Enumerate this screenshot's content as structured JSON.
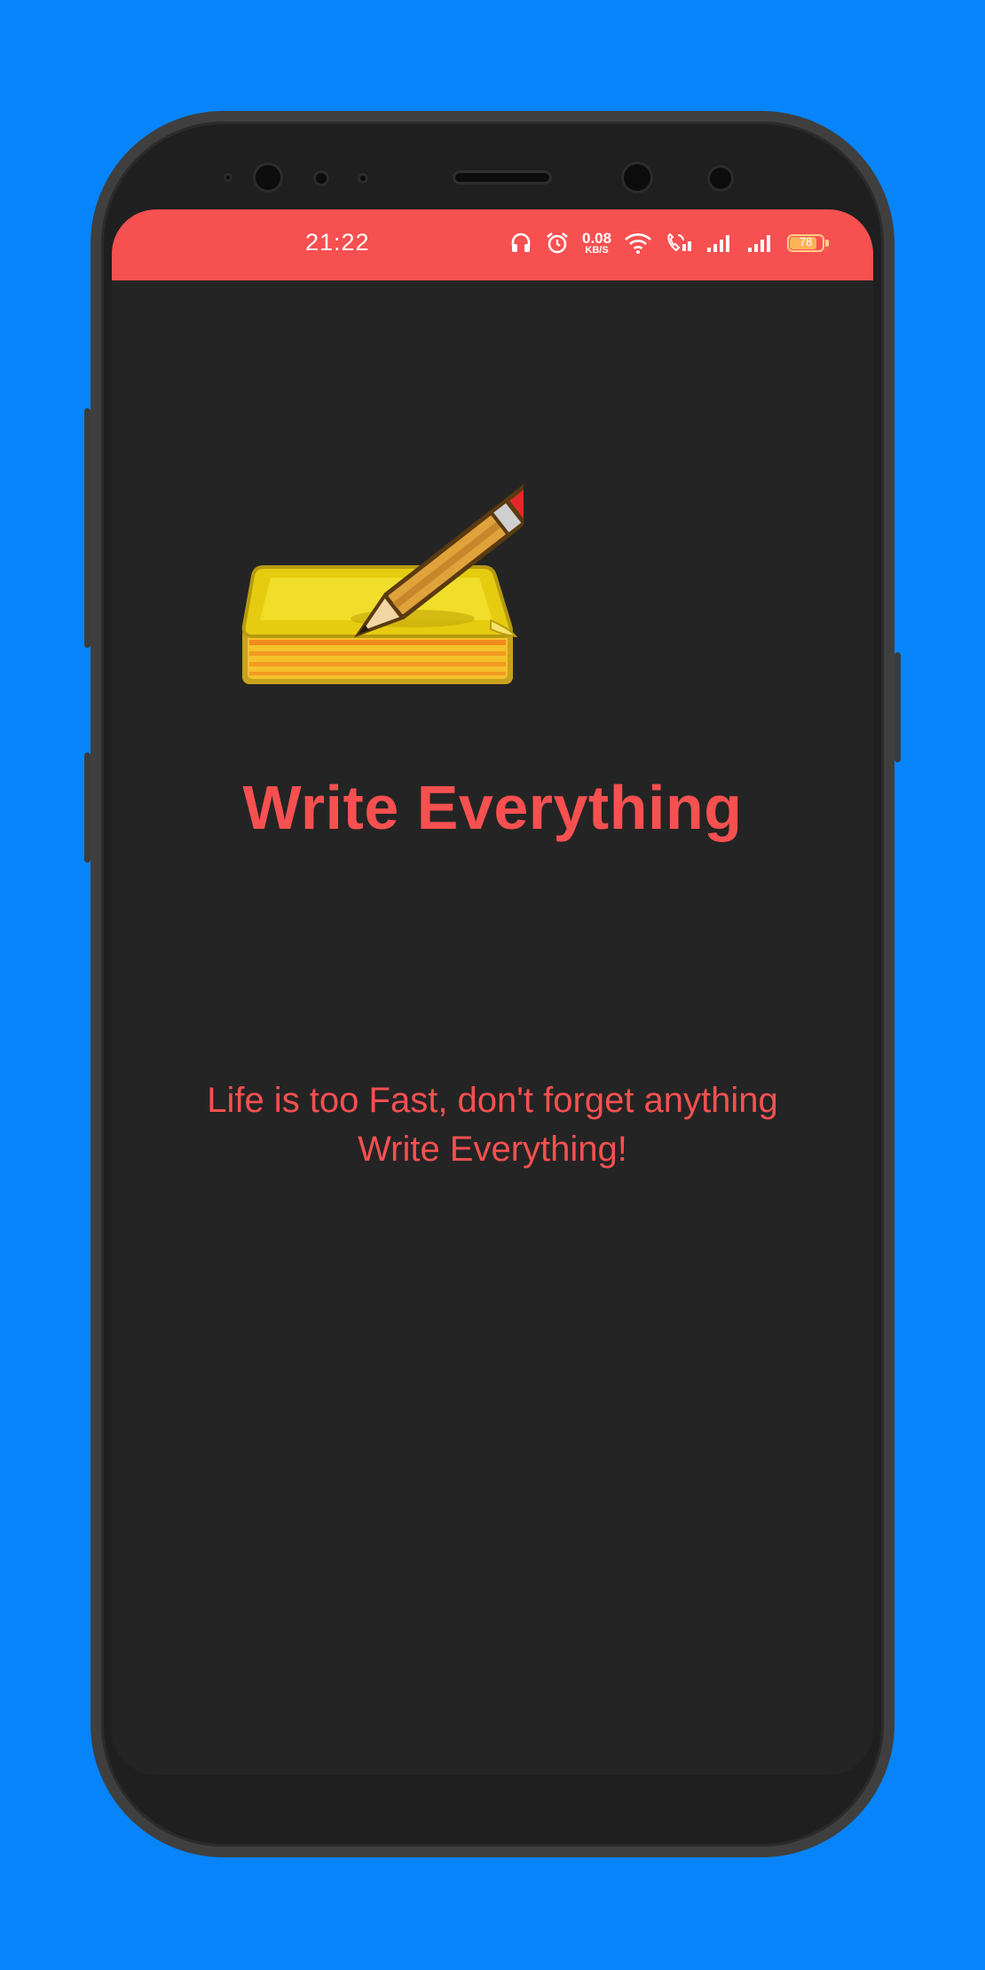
{
  "colors": {
    "background": "#0784FA",
    "accent": "#F75050",
    "screen": "#242424"
  },
  "status_bar": {
    "time": "21:22",
    "net_speed_value": "0.08",
    "net_speed_unit": "KB/S",
    "battery_level": "78",
    "icons": [
      "headphones-icon",
      "alarm-icon",
      "wifi-icon",
      "volte-call-icon",
      "signal-icon",
      "signal-icon",
      "battery-icon"
    ]
  },
  "splash": {
    "logo_icon": "notepad-pencil-icon",
    "title": "Write Everything",
    "subtitle_line1": "Life is too Fast, don't forget anything",
    "subtitle_line2": "Write Everything!"
  }
}
